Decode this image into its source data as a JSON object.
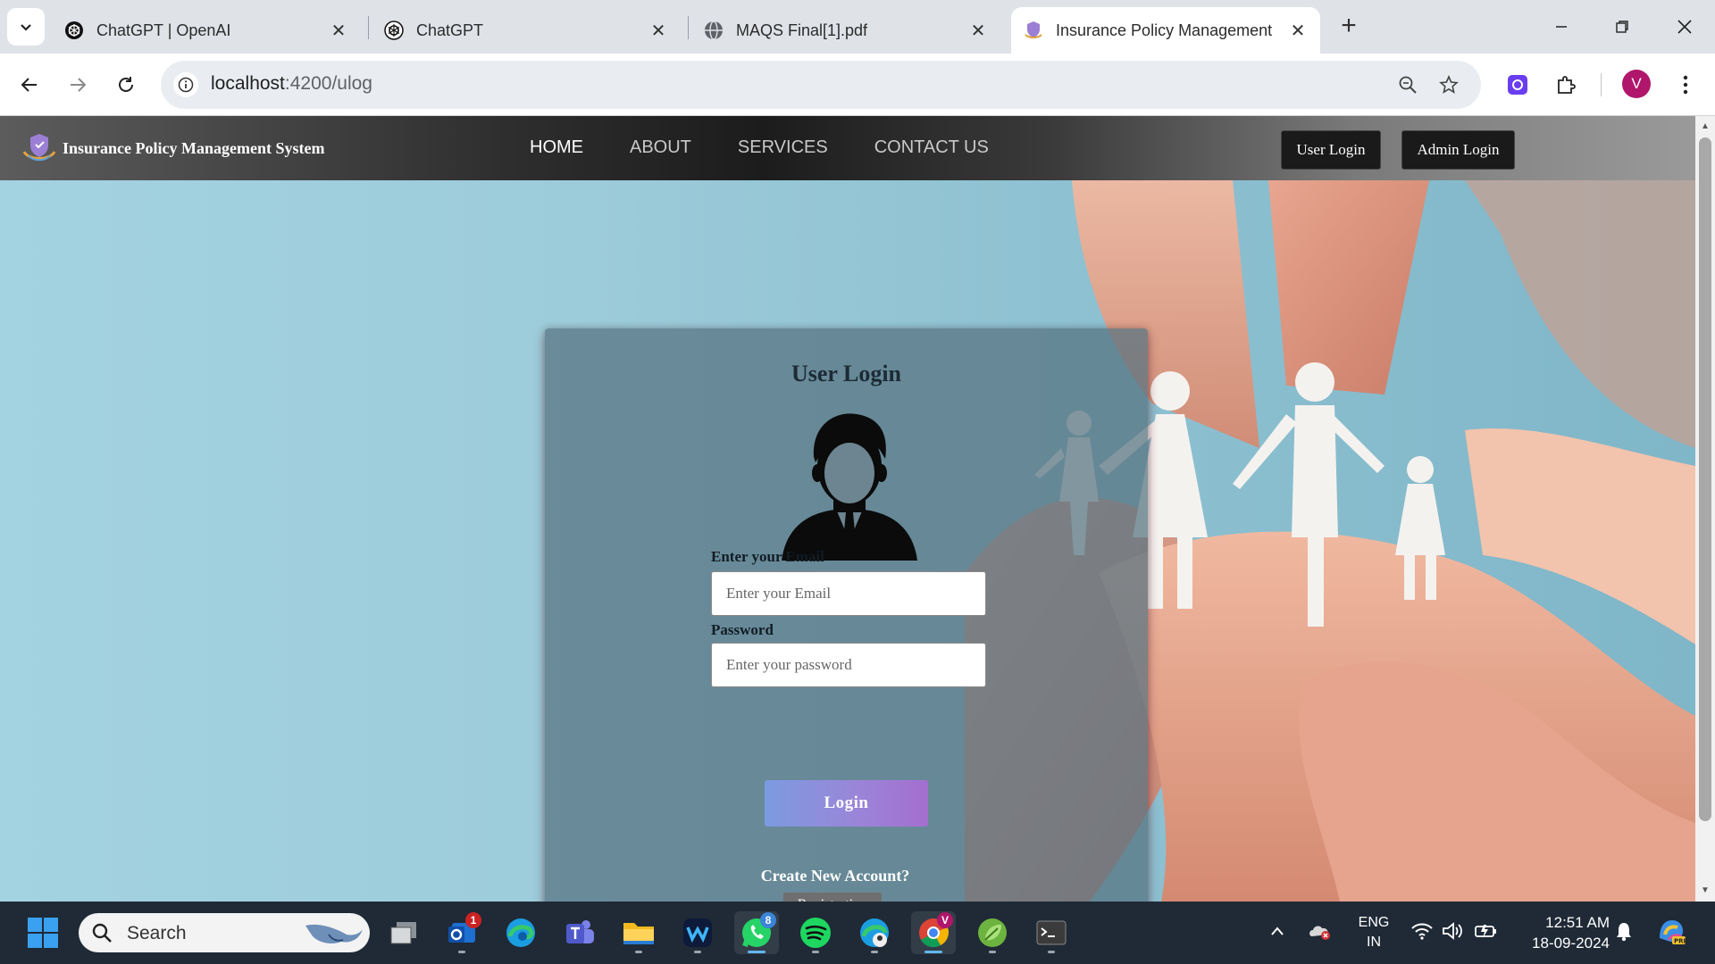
{
  "browser": {
    "tabs": [
      {
        "title": "ChatGPT | OpenAI",
        "icon": "openai-icon"
      },
      {
        "title": "ChatGPT",
        "icon": "openai-icon"
      },
      {
        "title": "MAQS Final[1].pdf",
        "icon": "globe-icon"
      },
      {
        "title": "Insurance Policy Management",
        "icon": "shield-logo-icon",
        "active": true
      }
    ],
    "url_host": "localhost",
    "url_path": ":4200/ulog",
    "profile_initial": "V"
  },
  "site": {
    "brand": "Insurance Policy Management System",
    "nav": [
      {
        "label": "HOME",
        "active": true
      },
      {
        "label": "ABOUT"
      },
      {
        "label": "SERVICES"
      },
      {
        "label": "CONTACT US"
      }
    ],
    "user_login_btn": "User Login",
    "admin_login_btn": "Admin Login"
  },
  "login": {
    "title": "User Login",
    "email_label": "Enter your Email",
    "email_placeholder": "Enter your Email",
    "email_value": "",
    "password_label": "Password",
    "password_placeholder": "Enter your password",
    "password_value": "",
    "submit": "Login",
    "create_prompt": "Create New Account?",
    "register_btn": "Registration"
  },
  "taskbar": {
    "search_placeholder": "Search",
    "apps": [
      {
        "name": "task-view-app"
      },
      {
        "name": "outlook-app",
        "badge": "1"
      },
      {
        "name": "edge-app"
      },
      {
        "name": "teams-app"
      },
      {
        "name": "file-explorer-app"
      },
      {
        "name": "webex-app"
      },
      {
        "name": "whatsapp-app",
        "badge": "8"
      },
      {
        "name": "spotify-app"
      },
      {
        "name": "edge-profile-app"
      },
      {
        "name": "chrome-app",
        "active": true
      },
      {
        "name": "spring-app"
      },
      {
        "name": "terminal-app"
      }
    ],
    "lang_line1": "ENG",
    "lang_line2": "IN",
    "time": "12:51 AM",
    "date": "18-09-2024"
  },
  "colors": {
    "accent_gradient_start": "#7b9be0",
    "accent_gradient_end": "#a46ed0",
    "navbar": "#1c1c1c",
    "card": "#567280",
    "hero": "#9ccbd9"
  }
}
